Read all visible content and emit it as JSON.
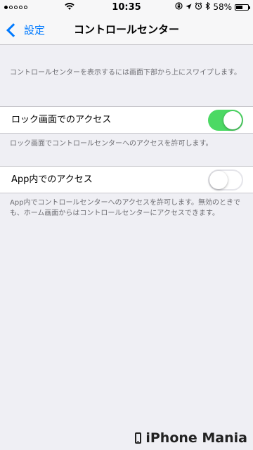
{
  "status_bar": {
    "time": "10:35",
    "battery": "58%",
    "battery_level": 0.58,
    "icons": [
      "signal-dots-icon",
      "wifi-icon",
      "lock-rotation-icon",
      "location-icon",
      "alarm-icon",
      "bluetooth-icon",
      "battery-icon"
    ]
  },
  "nav": {
    "back_label": "設定",
    "title": "コントロールセンター"
  },
  "intro_text": "コントロールセンターを表示するには画面下部から上にスワイプします。",
  "settings": [
    {
      "label": "ロック画面でのアクセス",
      "enabled": true,
      "footer": "ロック画面でコントロールセンターへのアクセスを許可します。"
    },
    {
      "label": "App内でのアクセス",
      "enabled": false,
      "footer": "App内でコントロールセンターへのアクセスを許可します。無効のときでも、ホーム画面からはコントロールセンターにアクセスできます。"
    }
  ],
  "colors": {
    "accent": "#007aff",
    "toggle_on": "#4cd964",
    "background": "#efeff4"
  },
  "watermark": {
    "text": "iPhone Mania"
  }
}
